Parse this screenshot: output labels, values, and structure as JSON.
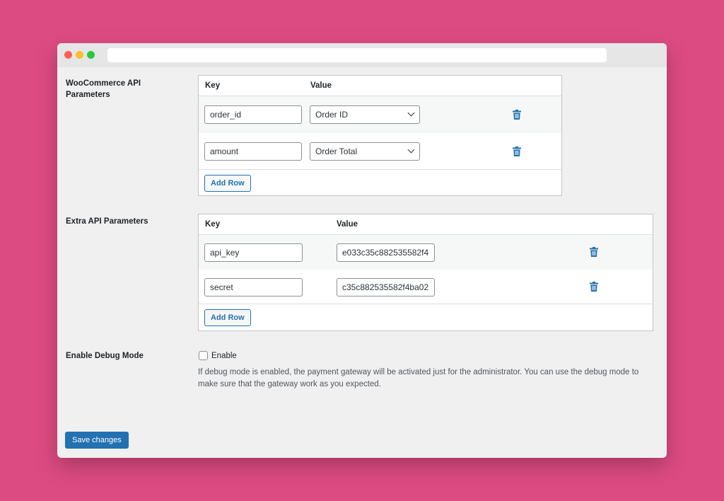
{
  "colors": {
    "background": "#dd4b83",
    "accent": "#2271b1",
    "window": "#f0f0f1"
  },
  "woo_section": {
    "label": "WooCommerce API Parameters",
    "headers": {
      "key": "Key",
      "value": "Value"
    },
    "rows": [
      {
        "key": "order_id",
        "value": "Order ID",
        "icon": "trash-icon"
      },
      {
        "key": "amount",
        "value": "Order Total",
        "icon": "trash-icon"
      }
    ],
    "add_row_label": "Add Row"
  },
  "extra_section": {
    "label": "Extra API Parameters",
    "headers": {
      "key": "Key",
      "value": "Value"
    },
    "rows": [
      {
        "key": "api_key",
        "value": "e033c35c882535582f4",
        "icon": "trash-icon"
      },
      {
        "key": "secret",
        "value": "c35c882535582f4ba02",
        "icon": "trash-icon"
      }
    ],
    "add_row_label": "Add Row"
  },
  "debug": {
    "label": "Enable Debug Mode",
    "checkbox_label": "Enable",
    "checked": false,
    "description_line1": "If debug mode is enabled, the payment gateway will be activated just for the administrator. You can use the debug mode to",
    "description_line2": "make sure that the gateway work as you expected."
  },
  "save_label": "Save changes"
}
